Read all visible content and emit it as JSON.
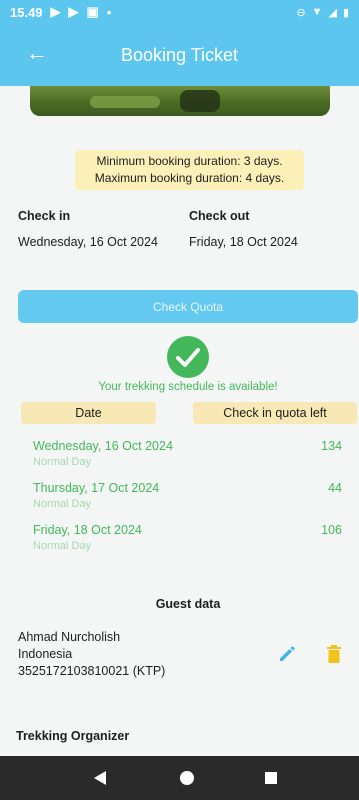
{
  "status_bar": {
    "time": "15.49"
  },
  "header": {
    "back_icon": "arrow-left-icon",
    "title": "Booking Ticket"
  },
  "info_box": {
    "line1": "Minimum booking duration: 3 days.",
    "line2": "Maximum booking duration: 4 days."
  },
  "check_in": {
    "label": "Check in",
    "value": "Wednesday, 16 Oct 2024"
  },
  "check_out": {
    "label": "Check out",
    "value": "Friday, 18 Oct 2024"
  },
  "check_quota_button": "Check Quota",
  "availability": {
    "message": "Your trekking schedule is available!",
    "columns": [
      "Date",
      "Check in quota left"
    ],
    "rows": [
      {
        "date": "Wednesday, 16 Oct 2024",
        "type": "Normal Day",
        "quota": "134"
      },
      {
        "date": "Thursday, 17 Oct 2024",
        "type": "Normal Day",
        "quota": "44"
      },
      {
        "date": "Friday, 18 Oct 2024",
        "type": "Normal Day",
        "quota": "106"
      }
    ]
  },
  "guest_data": {
    "title": "Guest data",
    "name": "Ahmad Nurcholish",
    "country": "Indonesia",
    "id_number": "3525172103810021 (KTP)"
  },
  "trekking_organizer": {
    "title": "Trekking Organizer"
  },
  "colors": {
    "primary": "#5cc6ee",
    "success": "#43b85a",
    "highlight": "#fbf0b8",
    "edit_icon": "#3fb6e6",
    "delete_icon": "#f2c31c"
  }
}
